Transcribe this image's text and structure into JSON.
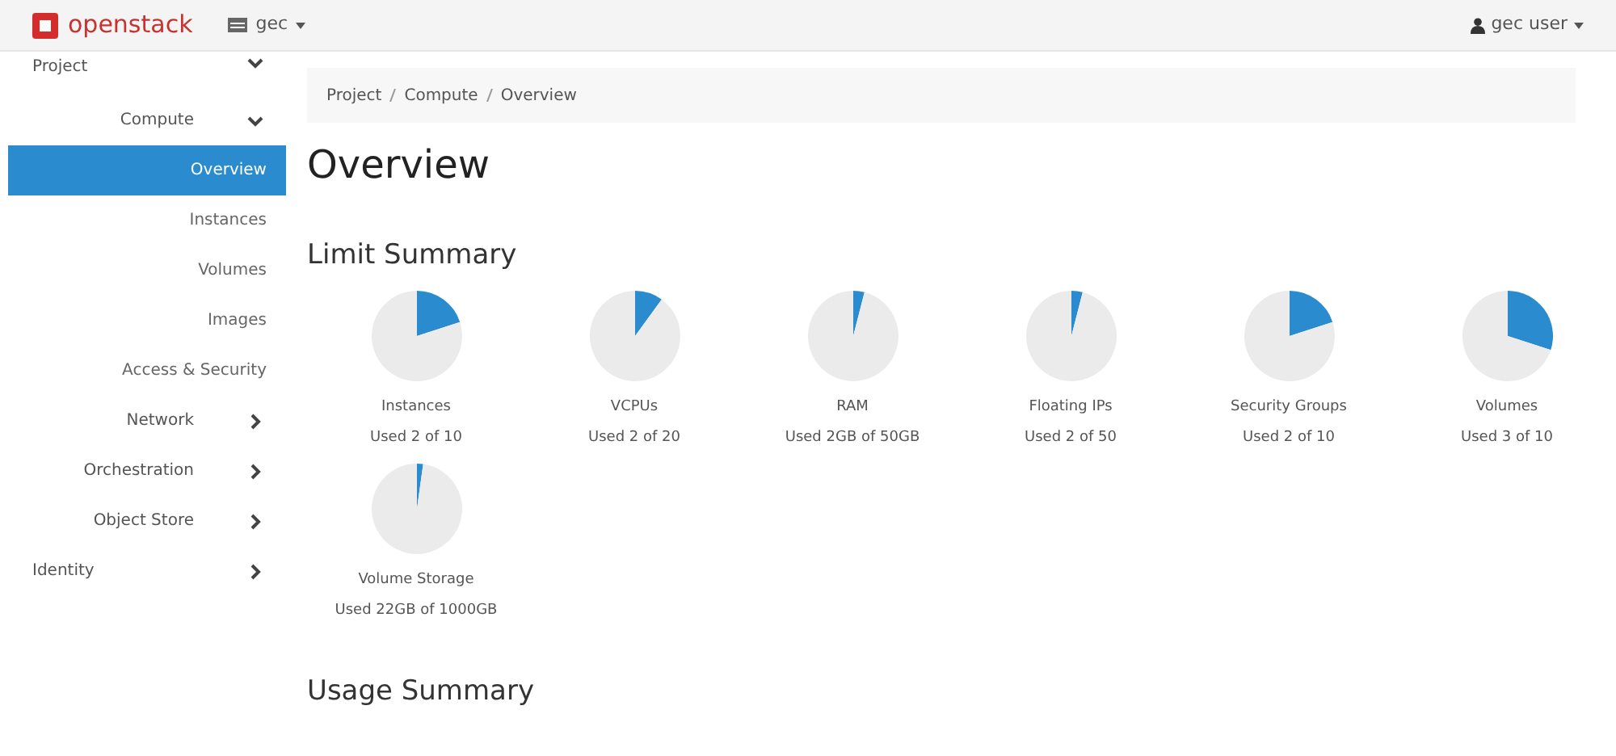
{
  "topbar": {
    "brand": "openstack",
    "project_menu": "gec",
    "user_menu": "gec user"
  },
  "sidebar": {
    "items": [
      {
        "kind": "section",
        "label": "Project",
        "expanded": true
      },
      {
        "kind": "group",
        "label": "Compute",
        "expanded": true
      },
      {
        "kind": "item",
        "label": "Overview",
        "selected": true
      },
      {
        "kind": "item",
        "label": "Instances",
        "selected": false
      },
      {
        "kind": "item",
        "label": "Volumes",
        "selected": false
      },
      {
        "kind": "item",
        "label": "Images",
        "selected": false
      },
      {
        "kind": "item",
        "label": "Access & Security",
        "selected": false
      },
      {
        "kind": "group",
        "label": "Network",
        "expanded": false
      },
      {
        "kind": "group",
        "label": "Orchestration",
        "expanded": false
      },
      {
        "kind": "group",
        "label": "Object Store",
        "expanded": false
      },
      {
        "kind": "section",
        "label": "Identity",
        "expanded": false
      }
    ]
  },
  "breadcrumb": [
    "Project",
    "Compute",
    "Overview"
  ],
  "page_title": "Overview",
  "limit_summary": {
    "title": "Limit Summary",
    "limits": [
      {
        "name": "Instances",
        "used": "Used 2 of 10",
        "chart_data": {
          "type": "pie",
          "values": [
            20,
            80
          ]
        }
      },
      {
        "name": "VCPUs",
        "used": "Used 2 of 20",
        "chart_data": {
          "type": "pie",
          "values": [
            10,
            90
          ]
        }
      },
      {
        "name": "RAM",
        "used": "Used 2GB of 50GB",
        "chart_data": {
          "type": "pie",
          "values": [
            4,
            96
          ]
        }
      },
      {
        "name": "Floating IPs",
        "used": "Used 2 of 50",
        "chart_data": {
          "type": "pie",
          "values": [
            4,
            96
          ]
        }
      },
      {
        "name": "Security Groups",
        "used": "Used 2 of 10",
        "chart_data": {
          "type": "pie",
          "values": [
            20,
            80
          ]
        }
      },
      {
        "name": "Volumes",
        "used": "Used 3 of 10",
        "chart_data": {
          "type": "pie",
          "values": [
            30,
            70
          ]
        }
      },
      {
        "name": "Volume Storage",
        "used": "Used 22GB of 1000GB",
        "chart_data": {
          "type": "pie",
          "values": [
            2.2,
            97.8
          ]
        }
      }
    ]
  },
  "usage_summary": {
    "title": "Usage Summary"
  }
}
